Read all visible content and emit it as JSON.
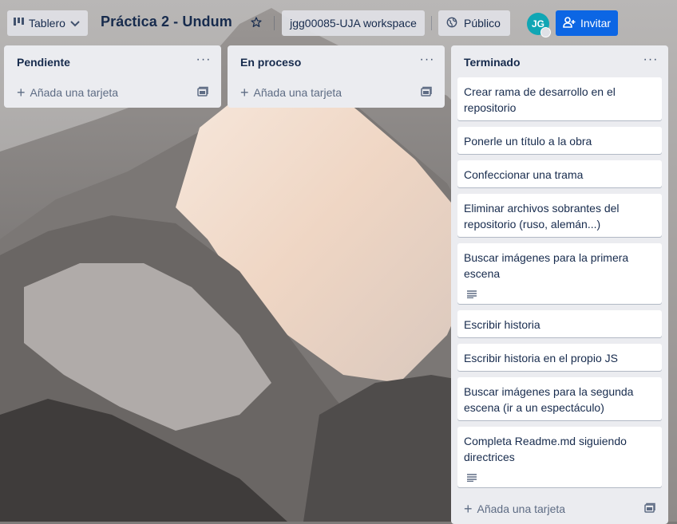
{
  "header": {
    "board_menu_label": "Tablero",
    "board_title": "Práctica 2 - Undum",
    "workspace_label": "jgg00085-UJA workspace",
    "visibility_label": "Público",
    "avatar_initials": "JG",
    "invite_label": "Invitar"
  },
  "lists": [
    {
      "title": "Pendiente",
      "add_label": "Añada una tarjeta",
      "cards": []
    },
    {
      "title": "En proceso",
      "add_label": "Añada una tarjeta",
      "cards": []
    },
    {
      "title": "Terminado",
      "add_label": "Añada una tarjeta",
      "cards": [
        {
          "title": "Crear rama de desarrollo en el repositorio",
          "has_description": false
        },
        {
          "title": "Ponerle un título a la obra",
          "has_description": false
        },
        {
          "title": "Confeccionar una trama",
          "has_description": false
        },
        {
          "title": "Eliminar archivos sobrantes del repositorio (ruso, alemán...)",
          "has_description": false
        },
        {
          "title": "Buscar imágenes para la primera escena",
          "has_description": true
        },
        {
          "title": "Escribir historia",
          "has_description": false
        },
        {
          "title": "Escribir historia en el propio JS",
          "has_description": false
        },
        {
          "title": "Buscar imágenes para la segunda escena (ir a un espectáculo)",
          "has_description": false
        },
        {
          "title": "Completa Readme.md siguiendo directrices",
          "has_description": true
        }
      ]
    }
  ],
  "icons": {
    "board_menu": "board-icon",
    "chevron": "chevron-down-icon",
    "star": "star-icon",
    "visibility": "globe-icon",
    "invite": "add-user-icon",
    "list_menu": "more-icon",
    "add": "plus-icon",
    "template": "card-template-icon",
    "description": "description-icon"
  },
  "colors": {
    "list_bg": "#ebecf0",
    "invite_bg": "#0c66e4",
    "avatar_bg": "#10a6b4",
    "text": "#172b4d",
    "muted_text": "#5e6c84"
  }
}
